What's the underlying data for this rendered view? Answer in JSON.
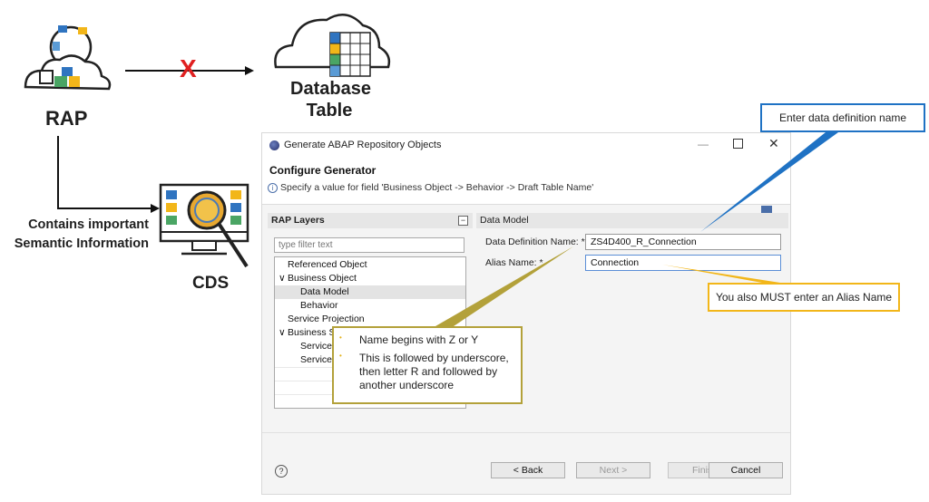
{
  "diagram": {
    "rap_label": "RAP",
    "database_label_line1": "Database",
    "database_label_line2": "Table",
    "cds_label": "CDS",
    "contains_line1": "Contains important",
    "contains_line2": "Semantic Information",
    "blocked_mark": "X",
    "colors": {
      "blocked": "#e02020",
      "connector": "#111111"
    }
  },
  "dialog": {
    "title": "Generate ABAP Repository Objects",
    "heading": "Configure Generator",
    "info_message": "Specify a value for field 'Business Object -> Behavior -> Draft Table Name'",
    "left_panel": {
      "title": "RAP Layers",
      "filter_placeholder": "type filter text",
      "tree": [
        {
          "label": "Referenced Object",
          "expander": "",
          "selected": false
        },
        {
          "label": "Business Object",
          "expander": "∨",
          "selected": false
        },
        {
          "label": "Data Model",
          "expander": "",
          "selected": true
        },
        {
          "label": "Behavior",
          "expander": "",
          "selected": false
        },
        {
          "label": "Service Projection",
          "expander": "",
          "selected": false
        },
        {
          "label": "Business S",
          "expander": "∨",
          "selected": false
        },
        {
          "label": "Service",
          "expander": "",
          "selected": false
        },
        {
          "label": "Service",
          "expander": "",
          "selected": false
        }
      ]
    },
    "right_panel": {
      "title": "Data Model",
      "data_definition_label": "Data Definition Name: *",
      "data_definition_value": "ZS4D400_R_Connection",
      "alias_label": "Alias Name: *",
      "alias_value": "Connection"
    },
    "buttons": {
      "back": "< Back",
      "next": "Next >",
      "finish": "Finish",
      "cancel": "Cancel"
    }
  },
  "callouts": {
    "data_definition": "Enter data definition name",
    "alias": "You also MUST enter an Alias Name",
    "naming_rules": [
      "Name begins with Z or Y",
      "This is followed by underscore, then letter R and followed by another underscore"
    ],
    "colors": {
      "blue": "#1f72c4",
      "yellow": "#f2b619",
      "olive": "#b3a13a"
    }
  }
}
